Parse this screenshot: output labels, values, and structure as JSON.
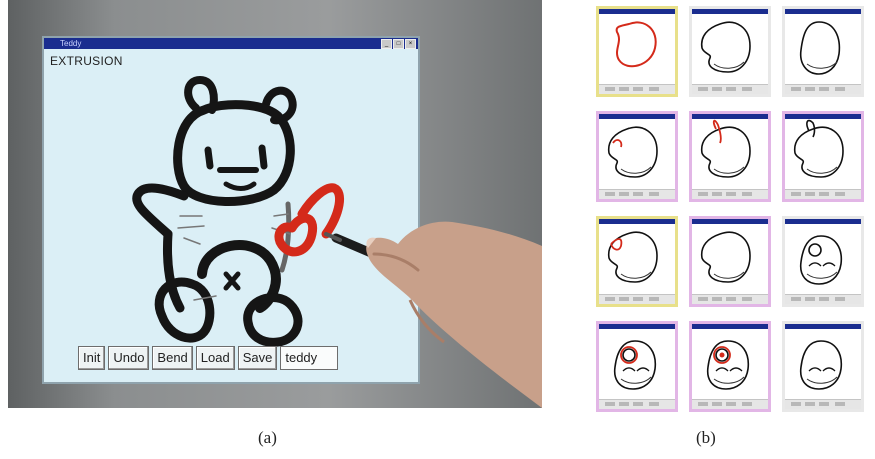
{
  "panel_a": {
    "window_title": "Teddy",
    "window_buttons": [
      "_",
      "□",
      "×"
    ],
    "mode_label": "EXTRUSION",
    "toolbar": {
      "buttons": [
        "Init",
        "Undo",
        "Bend",
        "Load",
        "Save"
      ],
      "file_name_value": "teddy"
    },
    "icons": [
      "pen-icon",
      "hand-icon"
    ],
    "stroke_colors": {
      "sketch": "#151515",
      "highlight": "#d42a1a"
    }
  },
  "panel_b": {
    "rows": 4,
    "columns": 3,
    "frame_colors": [
      "#e8e08a",
      "#e2b6e6",
      "#e8e8e8"
    ]
  },
  "captions": {
    "a": "(a)",
    "b": "(b)"
  }
}
